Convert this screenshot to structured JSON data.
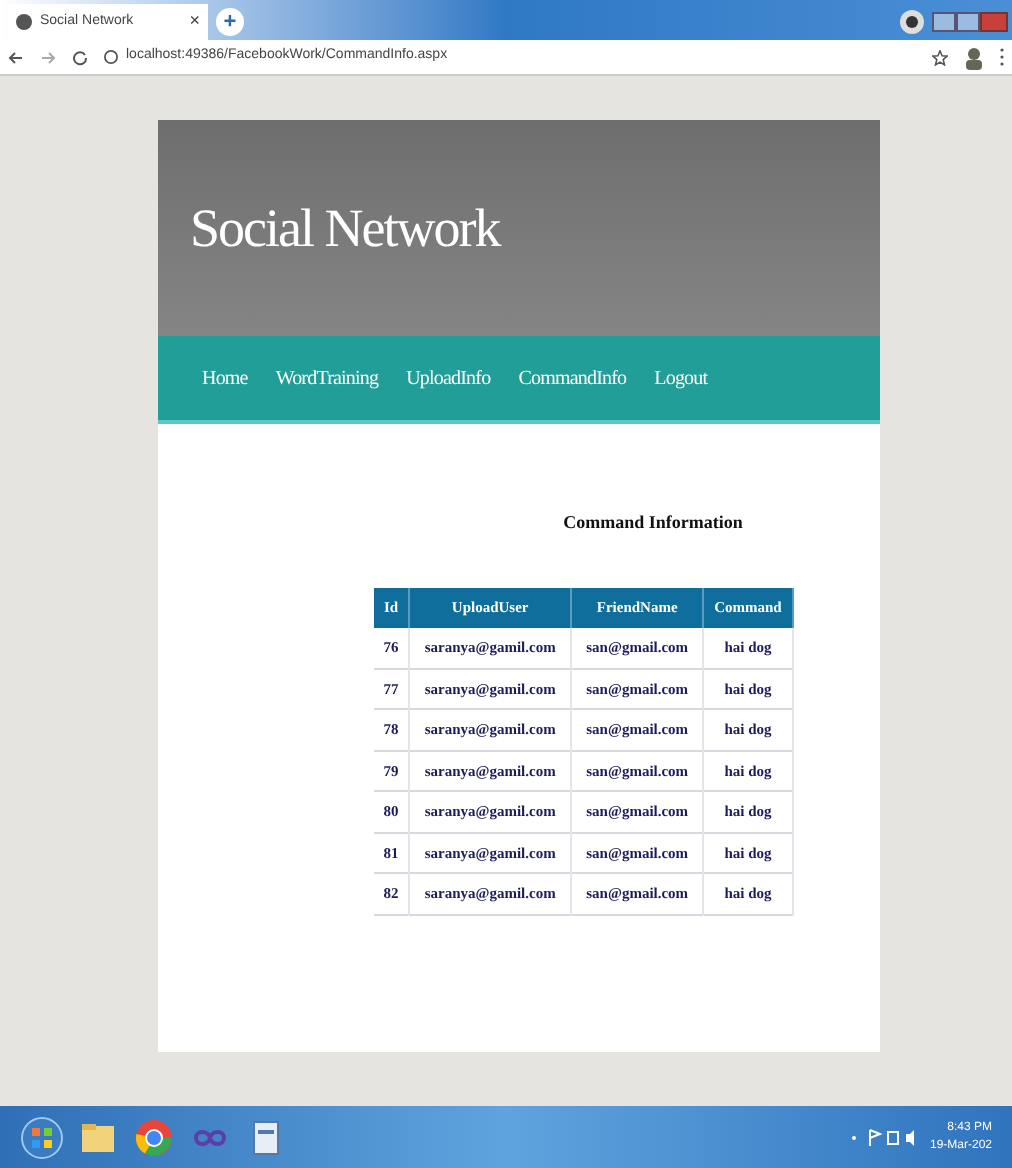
{
  "browser": {
    "tab_title": "Social Network",
    "close_label": "×",
    "new_tab_label": "+",
    "url": "localhost:49386/FacebookWork/CommandInfo.aspx"
  },
  "site": {
    "title": "Social Network",
    "nav": [
      {
        "label": "Home"
      },
      {
        "label": "WordTraining"
      },
      {
        "label": "UploadInfo"
      },
      {
        "label": "CommandInfo"
      },
      {
        "label": "Logout"
      }
    ]
  },
  "page": {
    "heading": "Command Information",
    "table": {
      "columns": [
        "Id",
        "UploadUser",
        "FriendName",
        "Command"
      ],
      "rows": [
        [
          "76",
          "saranya@gamil.com",
          "san@gmail.com",
          "hai dog"
        ],
        [
          "77",
          "saranya@gamil.com",
          "san@gmail.com",
          "hai dog"
        ],
        [
          "78",
          "saranya@gamil.com",
          "san@gmail.com",
          "hai dog"
        ],
        [
          "79",
          "saranya@gamil.com",
          "san@gmail.com",
          "hai dog"
        ],
        [
          "80",
          "saranya@gamil.com",
          "san@gmail.com",
          "hai dog"
        ],
        [
          "81",
          "saranya@gamil.com",
          "san@gmail.com",
          "hai dog"
        ],
        [
          "82",
          "saranya@gamil.com",
          "san@gmail.com",
          "hai dog"
        ]
      ]
    }
  },
  "taskbar": {
    "time": "8:43 PM",
    "date": "19-Mar-202"
  }
}
